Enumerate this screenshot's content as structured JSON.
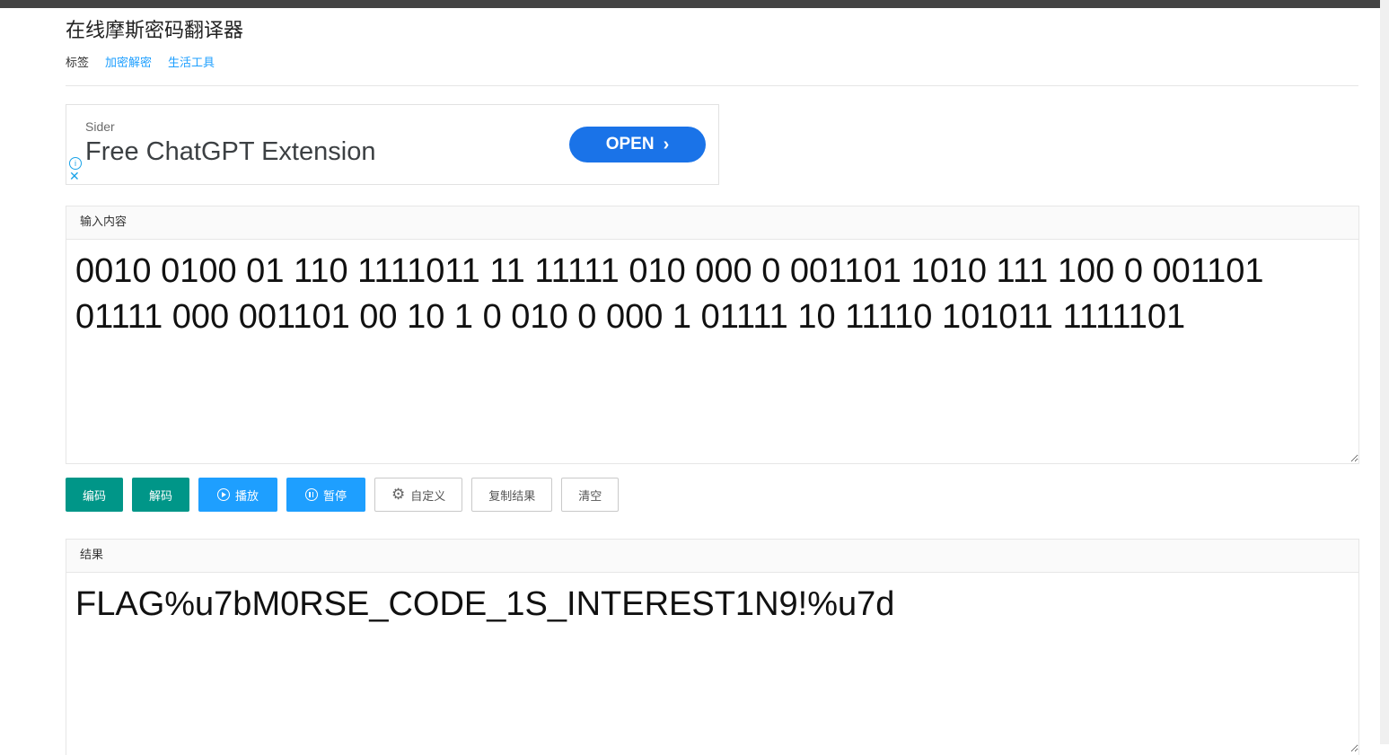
{
  "header": {
    "title": "在线摩斯密码翻译器",
    "tags_label": "标签",
    "tags": [
      "加密解密",
      "生活工具"
    ]
  },
  "ad": {
    "brand": "Sider",
    "headline": "Free ChatGPT Extension",
    "cta": "OPEN",
    "info_icon": "info-icon",
    "close_icon": "close-icon"
  },
  "input": {
    "label": "输入内容",
    "value": "0010 0100 01 110 1111011 11 11111 010 000 0 001101 1010 111 100 0 001101 01111 000 001101 00 10 1 0 010 0 000 1 01111 10 11110 101011 1111101"
  },
  "buttons": {
    "encode": "编码",
    "decode": "解码",
    "play": "播放",
    "pause": "暂停",
    "custom": "自定义",
    "copy": "复制结果",
    "clear": "清空"
  },
  "result": {
    "label": "结果",
    "value": "FLAG%u7bM0RSE_CODE_1S_INTEREST1N9!%u7d"
  },
  "colors": {
    "green": "#009688",
    "blue": "#1e9fff",
    "ad_button": "#1a73e8"
  }
}
